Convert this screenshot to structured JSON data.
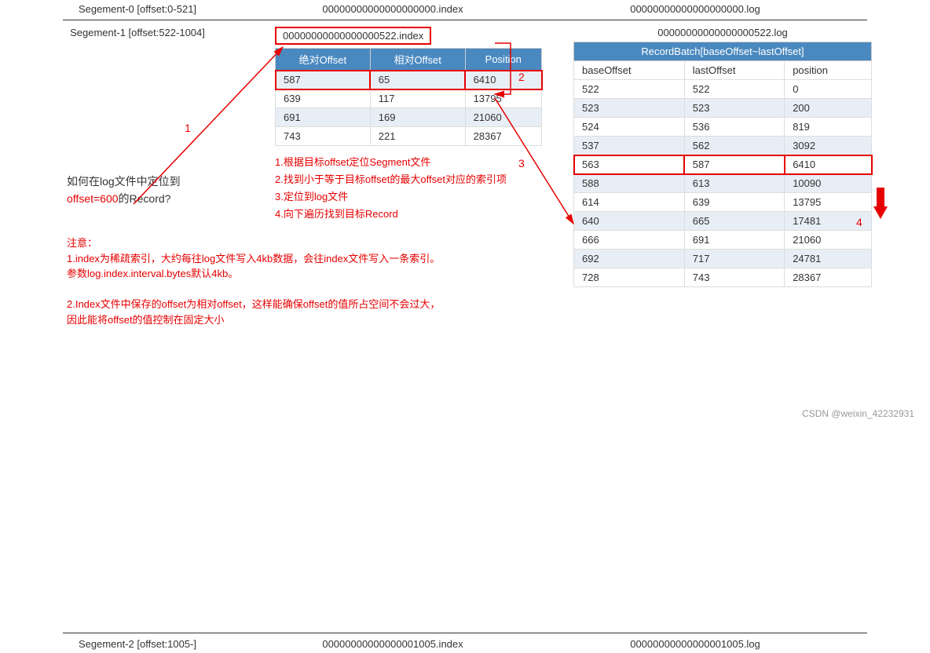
{
  "segments": {
    "s0": {
      "label": "Segement-0 [offset:0-521]",
      "index": "00000000000000000000.index",
      "log": "00000000000000000000.log"
    },
    "s1": {
      "label": "Segement-1 [offset:522-1004]",
      "index": "00000000000000000522.index",
      "log": "00000000000000000522.log"
    },
    "s2": {
      "label": "Segement-2 [offset:1005-]",
      "index": "00000000000000001005.index",
      "log": "00000000000000001005.log"
    }
  },
  "index_table": {
    "headers": {
      "abs": "绝对Offset",
      "rel": "相对Offset",
      "pos": "Position"
    },
    "rows": [
      {
        "abs": "587",
        "rel": "65",
        "pos": "6410"
      },
      {
        "abs": "639",
        "rel": "117",
        "pos": "13795"
      },
      {
        "abs": "691",
        "rel": "169",
        "pos": "21060"
      },
      {
        "abs": "743",
        "rel": "221",
        "pos": "28367"
      }
    ]
  },
  "log_table": {
    "header": "RecordBatch[baseOffset~lastOffset]",
    "sub": {
      "base": "baseOffset",
      "last": "lastOffset",
      "pos": "position"
    },
    "rows": [
      {
        "base": "522",
        "last": "522",
        "pos": "0"
      },
      {
        "base": "523",
        "last": "523",
        "pos": "200"
      },
      {
        "base": "524",
        "last": "536",
        "pos": "819"
      },
      {
        "base": "537",
        "last": "562",
        "pos": "3092"
      },
      {
        "base": "563",
        "last": "587",
        "pos": "6410"
      },
      {
        "base": "588",
        "last": "613",
        "pos": "10090"
      },
      {
        "base": "614",
        "last": "639",
        "pos": "13795"
      },
      {
        "base": "640",
        "last": "665",
        "pos": "17481"
      },
      {
        "base": "666",
        "last": "691",
        "pos": "21060"
      },
      {
        "base": "692",
        "last": "717",
        "pos": "24781"
      },
      {
        "base": "728",
        "last": "743",
        "pos": "28367"
      }
    ]
  },
  "question": {
    "line1": "如何在log文件中定位到",
    "line2_a": "offset=600",
    "line2_b": "的Record?"
  },
  "steps": {
    "s1": "1.根据目标offset定位Segment文件",
    "s2": "2.找到小于等于目标offset的最大offset对应的索引项",
    "s3": "3.定位到log文件",
    "s4": "4.向下遍历找到目标Record"
  },
  "notes": {
    "title": "注意：",
    "n1a": "1.index为稀疏索引，大约每往log文件写入4kb数据，会往index文件写入一条索引。",
    "n1b": "参数log.index.interval.bytes默认4kb。",
    "n2a": "2.Index文件中保存的offset为相对offset，这样能确保offset的值所占空间不会过大，",
    "n2b": "因此能将offset的值控制在固定大小"
  },
  "labels": {
    "l1": "1",
    "l2": "2",
    "l3": "3",
    "l4": "4"
  },
  "watermark": "CSDN @weixin_42232931"
}
